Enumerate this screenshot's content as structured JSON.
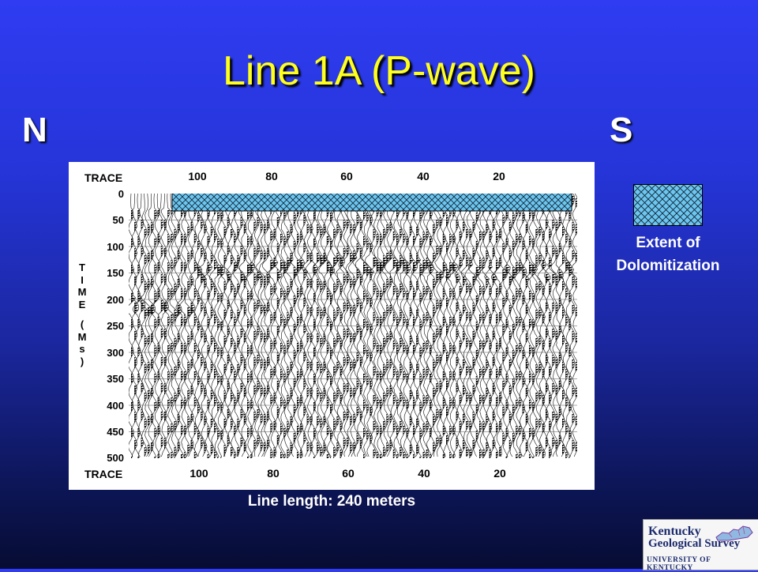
{
  "slide": {
    "title": "Line 1A (P-wave)",
    "north_label": "N",
    "south_label": "S",
    "line_length": "Line length: 240 meters"
  },
  "seismic": {
    "trace_label": "TRACE",
    "trace_ticks": [
      "100",
      "80",
      "60",
      "40",
      "20"
    ],
    "time_ticks": [
      "0",
      "50",
      "100",
      "150",
      "200",
      "250",
      "300",
      "350",
      "400",
      "450",
      "500"
    ],
    "time_axis_letters": [
      "T",
      "I",
      "M",
      "E",
      "(",
      "M",
      "s",
      ")"
    ],
    "time_range_ms": [
      0,
      500
    ],
    "dolomitization_band_ms": [
      0,
      30
    ]
  },
  "legend": {
    "line1": "Extent of",
    "line2": "Dolomitization",
    "color": "#6cc6ef"
  },
  "logo": {
    "line1": "Kentucky",
    "line2": "Geological Survey",
    "line3": "UNIVERSITY OF KENTUCKY"
  },
  "colors": {
    "title": "#ffff1e",
    "background_top": "#2f3cf2",
    "background_bottom": "#070c33"
  }
}
